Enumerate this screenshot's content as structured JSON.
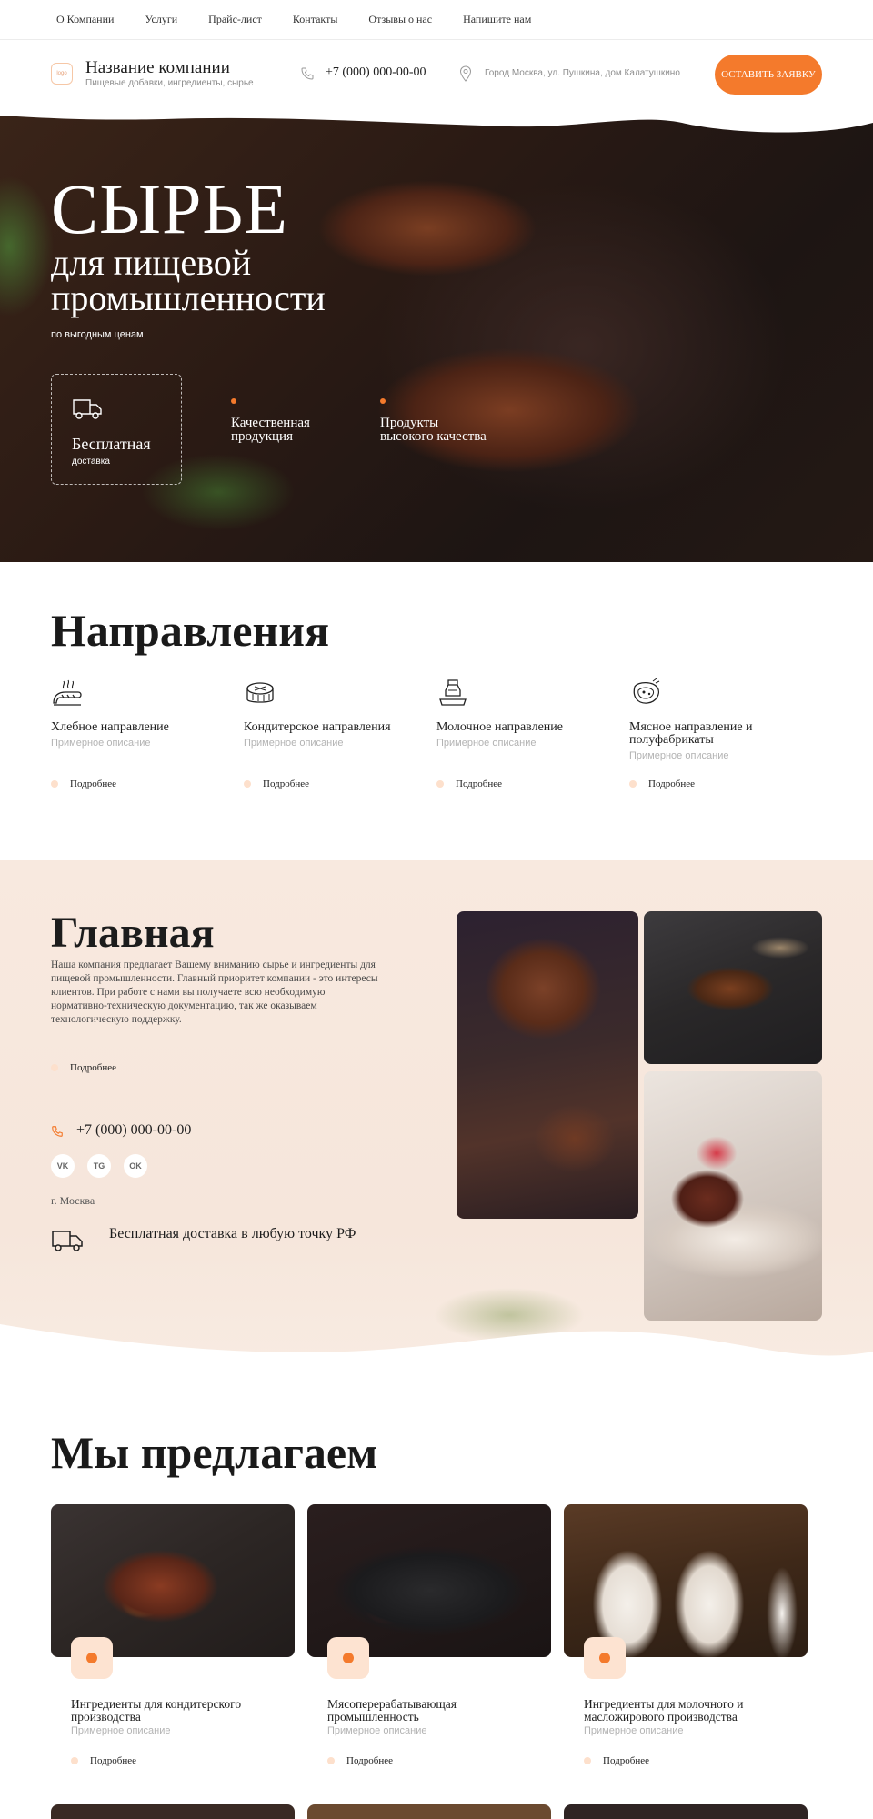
{
  "nav": {
    "items": [
      "О Компании",
      "Услуги",
      "Прайс-лист",
      "Контакты",
      "Отзывы о нас",
      "Напишите нам"
    ]
  },
  "header": {
    "logo_text": "logo",
    "company_name": "Название компании",
    "company_sub": "Пищевые добавки, ингредиенты, сырье",
    "phone": "+7 (000) 000-00-00",
    "address": "Город Москва, ул. Пушкина, дом Калатушкино",
    "cta_label": "ОСТАВИТЬ ЗАЯВКУ"
  },
  "hero": {
    "title": "СЫРЬЕ",
    "subtitle": "для пищевой промышленности",
    "note": "по выгодным ценам",
    "feature_box_title": "Бесплатная",
    "feature_box_sub": "доставка",
    "feature_2": "Качественная продукция",
    "feature_3": "Продукты высокого качества"
  },
  "directions": {
    "title": "Направления",
    "items": [
      {
        "name": "Хлебное направление",
        "desc": "Примерное описание",
        "more": "Подробнее",
        "icon": "bread-icon"
      },
      {
        "name": "Кондитерское  направления",
        "desc": "Примерное описание",
        "more": "Подробнее",
        "icon": "cake-icon"
      },
      {
        "name": "Молочное направление",
        "desc": "Примерное описание",
        "more": "Подробнее",
        "icon": "milk-icon"
      },
      {
        "name": "Мясное направление и полуфабрикаты",
        "desc": "Примерное описание",
        "more": "Подробнее",
        "icon": "meat-icon"
      }
    ]
  },
  "main": {
    "title": "Главная",
    "text": "Наша компания предлагает Вашему вниманию сырье и ингредиенты для пищевой промышленности. Главный приоритет компании - это интересы клиентов. При работе с нами вы получаете всю необходимую нормативно-техническую документацию, так же оказываем технологическую поддержку.",
    "more": "Подробнее",
    "phone": "+7 (000) 000-00-00",
    "social": [
      "VK",
      "TG",
      "OK"
    ],
    "city": "г. Москва",
    "delivery": "Бесплатная доставка в любую точку РФ"
  },
  "offer": {
    "title": "Мы предлагаем",
    "items": [
      {
        "name": "Ингредиенты для кондитерского производства",
        "desc": "Примерное описание",
        "more": "Подробнее"
      },
      {
        "name": "Мясоперерабатывающая промышленность",
        "desc": "Примерное описание",
        "more": "Подробнее"
      },
      {
        "name": "Ингредиенты для молочного и масложирового производства",
        "desc": "Примерное описание",
        "more": "Подробнее"
      }
    ]
  },
  "colors": {
    "accent": "#f47a2c",
    "accent_soft": "#fde3d1",
    "section_bg": "#f7e8dd"
  }
}
